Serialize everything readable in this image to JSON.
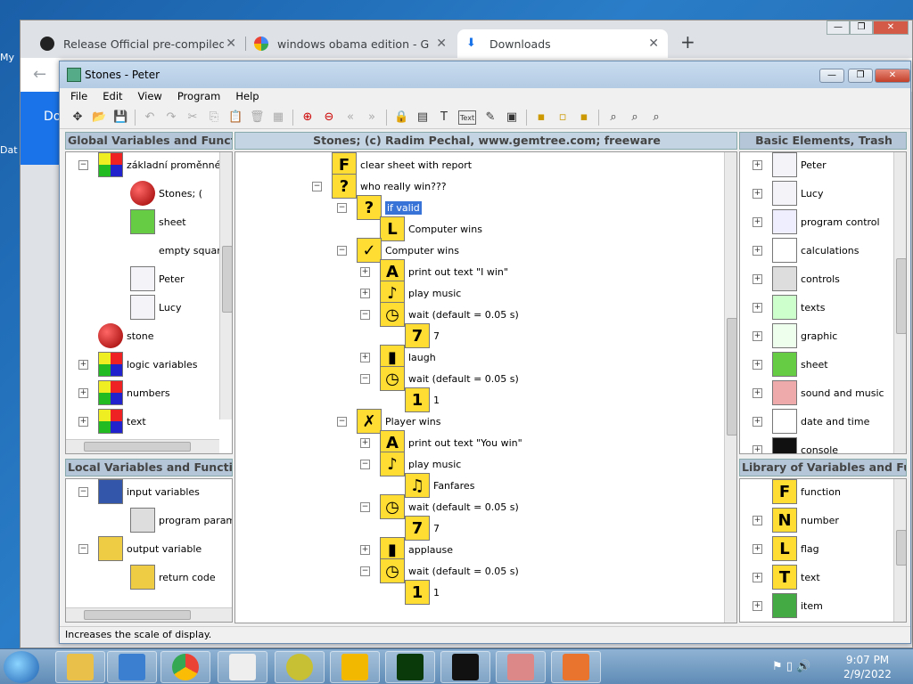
{
  "desktop": {
    "icons": [
      "My",
      "Dat"
    ]
  },
  "browser": {
    "tabs": [
      {
        "title": "Release Official pre-compiled ins",
        "favicon": "github-icon"
      },
      {
        "title": "windows obama edition - Googl",
        "favicon": "google-icon"
      },
      {
        "title": "Downloads",
        "favicon": "download-icon"
      }
    ],
    "side_label": "Do"
  },
  "app": {
    "title": "Stones - Peter",
    "menu": [
      "File",
      "Edit",
      "View",
      "Program",
      "Help"
    ],
    "panels": {
      "global_title": "Global Variables and Functio",
      "program_title": "Stones;   (c) Radim Pechal, www.gemtree.com;   freeware",
      "basic_title": "Basic Elements, Trash",
      "local_title": "Local Variables and Function",
      "library_title": "Library of Variables and Func"
    },
    "global_items": [
      {
        "label": "základní proměnné a",
        "icon": "group-icon"
      },
      {
        "label": "Stones;   (",
        "icon": "stone-icon"
      },
      {
        "label": "sheet",
        "icon": "sheet-icon"
      },
      {
        "label": "empty squar",
        "icon": "empty-icon"
      },
      {
        "label": "Peter",
        "icon": "bunny-icon"
      },
      {
        "label": "Lucy",
        "icon": "bunny-icon"
      },
      {
        "label": "stone",
        "icon": "stone-icon"
      },
      {
        "label": "logic variables",
        "icon": "group-icon"
      },
      {
        "label": "numbers",
        "icon": "group-icon"
      },
      {
        "label": "text",
        "icon": "group-icon"
      }
    ],
    "local_items": [
      {
        "label": "input variables",
        "icon": "input-icon"
      },
      {
        "label": "program parame",
        "icon": "param-icon"
      },
      {
        "label": "output variable",
        "icon": "output-icon"
      },
      {
        "label": "return code",
        "icon": "return-icon"
      }
    ],
    "program_items": [
      {
        "label": "clear sheet with report",
        "icon": "F"
      },
      {
        "label": "who really win???",
        "icon": "?"
      },
      {
        "label": "if valid",
        "icon": "?"
      },
      {
        "label": "Computer wins",
        "icon": "L"
      },
      {
        "label": "Computer wins",
        "icon": "✓"
      },
      {
        "label": "print out text \"I win\"",
        "icon": "A"
      },
      {
        "label": "play music",
        "icon": "♪"
      },
      {
        "label": "wait (default = 0.05 s)",
        "icon": "◷"
      },
      {
        "label": "7",
        "icon": "7"
      },
      {
        "label": "laugh",
        "icon": "▮"
      },
      {
        "label": "wait (default = 0.05 s)",
        "icon": "◷"
      },
      {
        "label": "1",
        "icon": "1"
      },
      {
        "label": "Player wins",
        "icon": "✗"
      },
      {
        "label": "print out text \"You win\"",
        "icon": "A"
      },
      {
        "label": "play music",
        "icon": "♪"
      },
      {
        "label": "Fanfares",
        "icon": "♫"
      },
      {
        "label": "wait (default = 0.05 s)",
        "icon": "◷"
      },
      {
        "label": "7",
        "icon": "7"
      },
      {
        "label": "applause",
        "icon": "▮"
      },
      {
        "label": "wait (default = 0.05 s)",
        "icon": "◷"
      },
      {
        "label": "1",
        "icon": "1"
      }
    ],
    "basic_items": [
      {
        "label": "Peter",
        "icon": "bunny-icon"
      },
      {
        "label": "Lucy",
        "icon": "bunny-icon"
      },
      {
        "label": "program control",
        "icon": "control-icon"
      },
      {
        "label": "calculations",
        "icon": "calc-icon"
      },
      {
        "label": "controls",
        "icon": "controls-icon"
      },
      {
        "label": "texts",
        "icon": "texts-icon"
      },
      {
        "label": "graphic",
        "icon": "graphic-icon"
      },
      {
        "label": "sheet",
        "icon": "sheet-icon"
      },
      {
        "label": "sound and music",
        "icon": "sound-icon"
      },
      {
        "label": "date and time",
        "icon": "clock-icon"
      },
      {
        "label": "console",
        "icon": "console-icon"
      }
    ],
    "library_items": [
      {
        "label": "function",
        "icon": "F"
      },
      {
        "label": "number",
        "icon": "N"
      },
      {
        "label": "flag",
        "icon": "L"
      },
      {
        "label": "text",
        "icon": "T"
      },
      {
        "label": "item",
        "icon": "item-icon"
      }
    ],
    "status": "Increases the scale of display.",
    "toolbar_text_label": "Text"
  },
  "taskbar": {
    "time": "9:07 PM",
    "date": "2/9/2022"
  }
}
